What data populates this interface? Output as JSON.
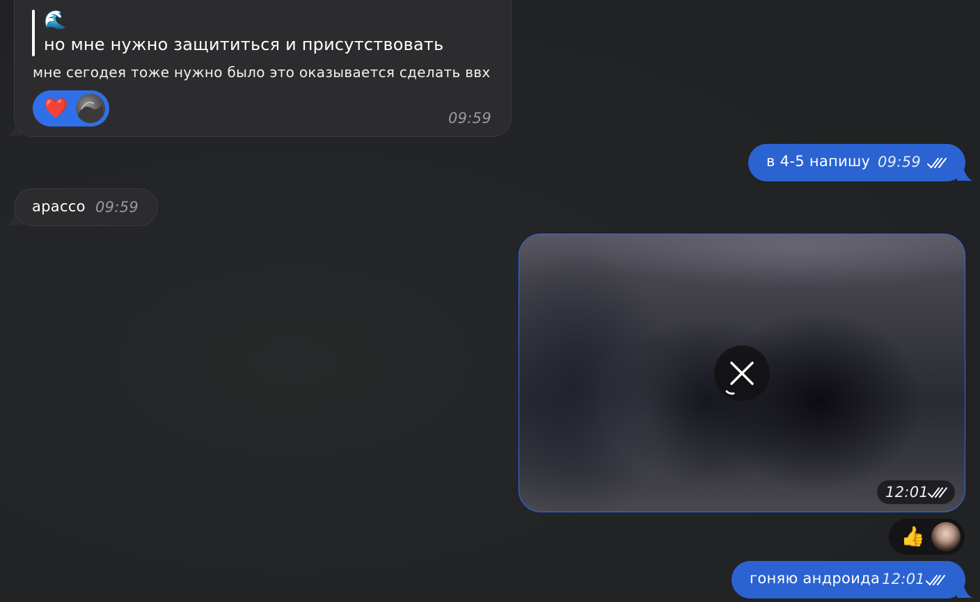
{
  "messages": {
    "m1": {
      "quote_emoji": "🌊",
      "quote_text": "но мне нужно защититься и присутствовать",
      "text": "мне сегодея тоже нужно было это оказывается сделать ввх",
      "reaction_emoji": "❤️",
      "time": "09:59"
    },
    "m2": {
      "text": "в 4-5 напишу",
      "time": "09:59",
      "status": "read"
    },
    "m3": {
      "text": "арассо",
      "time": "09:59"
    },
    "m4": {
      "type": "media",
      "time": "12:01",
      "status": "read",
      "overlay_icon": "close-icon"
    },
    "m4_reaction": {
      "emoji": "👍"
    },
    "m5": {
      "text": "гоняю андроида",
      "time": "12:01",
      "status": "read"
    }
  },
  "colors": {
    "background": "#222426",
    "incoming_bubble": "#2c2c2e",
    "outgoing_bubble": "#2b63d2",
    "reaction_accent": "#2f6fe8"
  }
}
